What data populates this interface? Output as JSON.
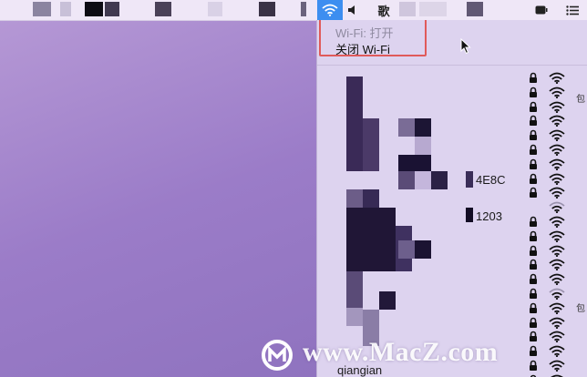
{
  "menubar": {
    "volume_icon": "speaker-icon",
    "app_char": "歌",
    "notification_icon": "list-icon",
    "wifi_icon": "wifi-icon"
  },
  "wifi_menu": {
    "status": "Wi-Fi: 打开",
    "toggle_label": "关闭 Wi-Fi",
    "networks": [
      {
        "name": "1005",
        "locked": true
      },
      {
        "name": "",
        "locked": true
      },
      {
        "name": "",
        "locked": true
      },
      {
        "name": "",
        "locked": true
      },
      {
        "name": "",
        "locked": true
      },
      {
        "name": "",
        "locked": true
      },
      {
        "name": "",
        "locked": true
      },
      {
        "name": "4E8C",
        "locked": true
      },
      {
        "name": "",
        "locked": true
      },
      {
        "name": "",
        "locked": false
      },
      {
        "name": "1203",
        "locked": true
      },
      {
        "name": "",
        "locked": true
      },
      {
        "name": "",
        "locked": true
      },
      {
        "name": "",
        "locked": true
      },
      {
        "name": "",
        "locked": true
      },
      {
        "name": "",
        "locked": true
      },
      {
        "name": "",
        "locked": true
      },
      {
        "name": "",
        "locked": true
      },
      {
        "name": "",
        "locked": true
      },
      {
        "name": "",
        "locked": true
      },
      {
        "name": "",
        "locked": true
      },
      {
        "name": "qiangian",
        "locked": true
      }
    ]
  },
  "edge_labels": [
    "包",
    "包"
  ],
  "watermark": {
    "text": "www.MacZ.com"
  }
}
